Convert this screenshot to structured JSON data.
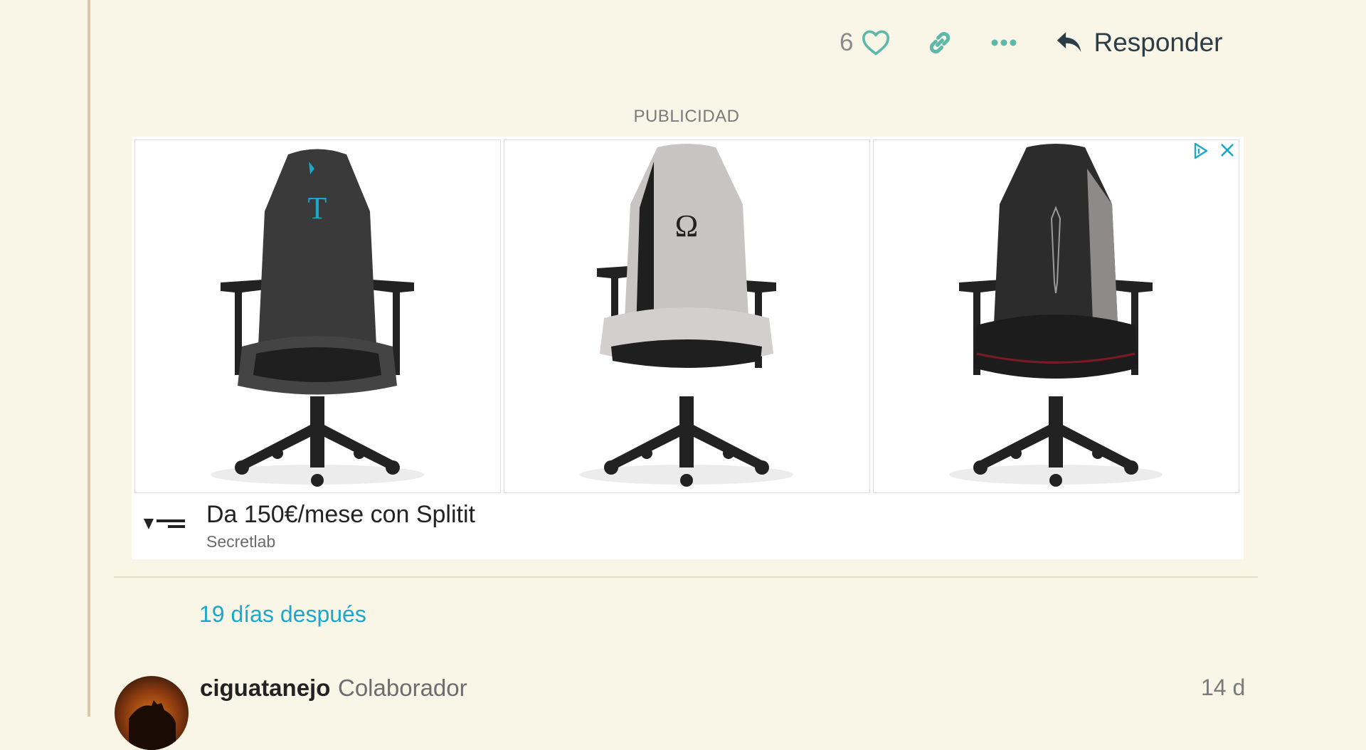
{
  "post_actions": {
    "like_count": "6",
    "reply_label": "Responder"
  },
  "ad": {
    "label": "PUBLICIDAD",
    "headline": "Da 150€/mese con Splitit",
    "advertiser": "Secretlab",
    "chairs": [
      {
        "symbol": "T"
      },
      {
        "symbol": "Ω"
      },
      {
        "symbol": ""
      }
    ]
  },
  "time_gap": "19 días después",
  "next_post": {
    "username": "ciguatanejo",
    "user_title": "Colaborador",
    "date": "14 d"
  },
  "colors": {
    "accent": "#1aa8cc",
    "heart": "#5cb8a8",
    "background": "#f9f5e7"
  }
}
